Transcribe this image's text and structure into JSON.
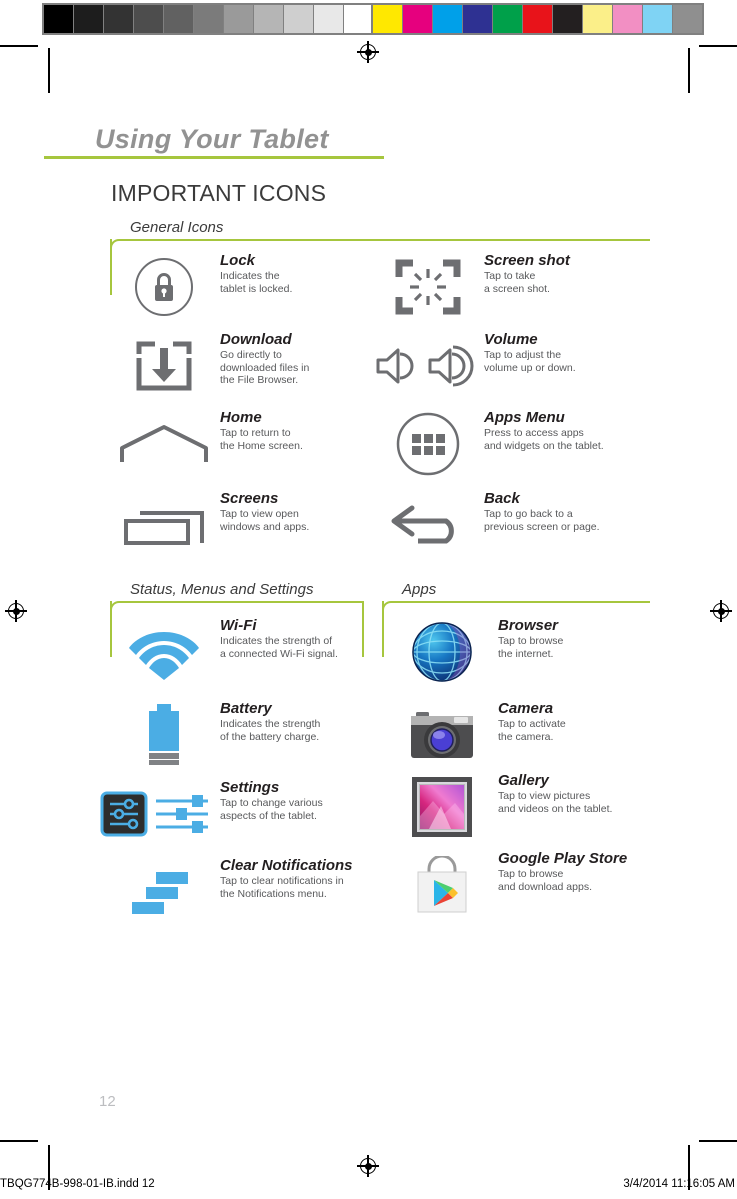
{
  "print_marks": {
    "grayscale_swatches": [
      "#000000",
      "#1d1d1d",
      "#333333",
      "#4d4d4d",
      "#616161",
      "#7b7b7b",
      "#9a9a9a",
      "#b5b5b5",
      "#cfcfcf",
      "#e8e8e8",
      "#ffffff"
    ],
    "color_swatches": [
      "#ffe800",
      "#e6007e",
      "#00a0e9",
      "#2e3192",
      "#00a04a",
      "#e8131a",
      "#231f20",
      "#fbef89",
      "#f28fc3",
      "#7fd3f4",
      "#8f8f8f"
    ]
  },
  "header": {
    "chapter_title": "Using Your Tablet",
    "section_title": "IMPORTANT ICONS",
    "accent_color": "#A6C63E"
  },
  "groups": [
    {
      "id": "general",
      "label": "General Icons"
    },
    {
      "id": "status",
      "label": "Status, Menus and Settings"
    },
    {
      "id": "apps",
      "label": "Apps"
    }
  ],
  "general_icons_left": [
    {
      "icon": "lock-icon",
      "title": "Lock",
      "desc_lines": [
        "Indicates the",
        "tablet is locked."
      ]
    },
    {
      "icon": "download-icon",
      "title": "Download",
      "desc_lines": [
        "Go directly to",
        "downloaded files in",
        "the File Browser."
      ]
    },
    {
      "icon": "home-icon",
      "title": "Home",
      "desc_lines": [
        "Tap to return to",
        "the Home screen."
      ]
    },
    {
      "icon": "screens-icon",
      "title": "Screens",
      "desc_lines": [
        "Tap to view open",
        "windows and apps."
      ]
    }
  ],
  "general_icons_right": [
    {
      "icon": "screenshot-icon",
      "title": "Screen shot",
      "desc_lines": [
        "Tap to take",
        "a screen shot."
      ]
    },
    {
      "icon": "volume-icon",
      "title": "Volume",
      "desc_lines": [
        "Tap to adjust the",
        "volume up or down."
      ]
    },
    {
      "icon": "apps-menu-icon",
      "title": "Apps Menu",
      "desc_lines": [
        "Press to access apps",
        "and widgets on the tablet."
      ]
    },
    {
      "icon": "back-icon",
      "title": "Back",
      "desc_lines": [
        "Tap to go back to a",
        "previous screen or page."
      ]
    }
  ],
  "status_icons": [
    {
      "icon": "wifi-icon",
      "title": "Wi-Fi",
      "desc_lines": [
        "Indicates the strength of",
        "a connected Wi-Fi signal."
      ]
    },
    {
      "icon": "battery-icon",
      "title": "Battery",
      "desc_lines": [
        "Indicates the strength",
        "of the battery charge."
      ]
    },
    {
      "icon": "settings-icon",
      "title": "Settings",
      "desc_lines": [
        "Tap to change various",
        "aspects of the tablet."
      ]
    },
    {
      "icon": "clear-notifications-icon",
      "title": "Clear Notifications",
      "desc_lines": [
        "Tap to clear notifications in",
        "the Notifications menu."
      ]
    }
  ],
  "app_icons": [
    {
      "icon": "browser-icon",
      "title": "Browser",
      "desc_lines": [
        "Tap to browse",
        "the internet."
      ]
    },
    {
      "icon": "camera-icon",
      "title": "Camera",
      "desc_lines": [
        "Tap to activate",
        "the camera."
      ]
    },
    {
      "icon": "gallery-icon",
      "title": "Gallery",
      "desc_lines": [
        "Tap to view pictures",
        "and videos on the tablet."
      ]
    },
    {
      "icon": "google-play-store-icon",
      "title": "Google Play Store",
      "desc_lines": [
        "Tap to browse",
        "and download apps."
      ]
    }
  ],
  "footer": {
    "page_number": "12",
    "imposition_filename": "TBQG774B-998-01-IB.indd   12",
    "imposition_timestamp": "3/4/2014   11:16:05 AM"
  }
}
